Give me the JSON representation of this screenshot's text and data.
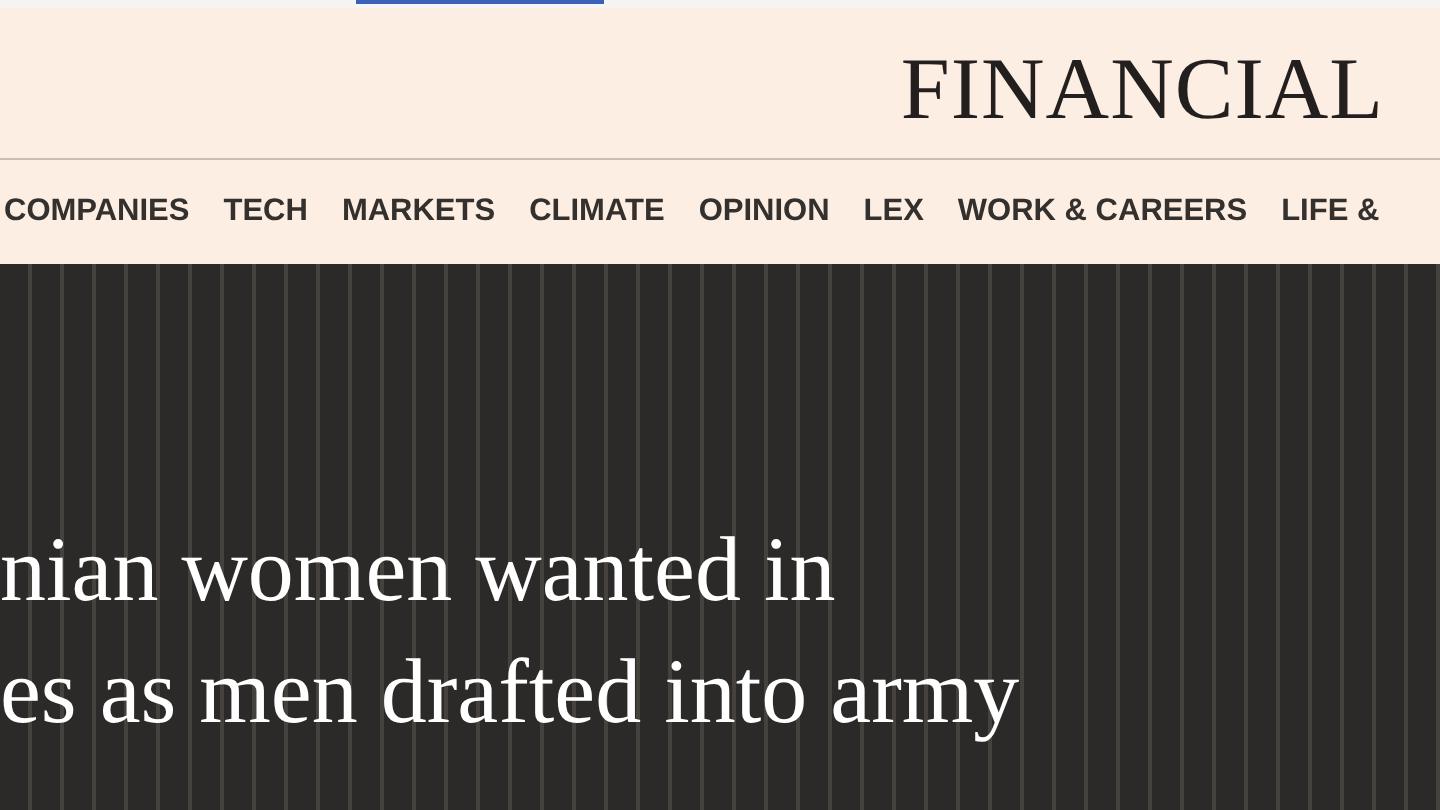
{
  "masthead": {
    "title": "FINANCIAL"
  },
  "nav": {
    "items": [
      "COMPANIES",
      "TECH",
      "MARKETS",
      "CLIMATE",
      "OPINION",
      "LEX",
      "WORK & CAREERS",
      "LIFE &"
    ]
  },
  "hero": {
    "headline_lines": [
      "nian women wanted in",
      "es as men drafted into army"
    ]
  }
}
